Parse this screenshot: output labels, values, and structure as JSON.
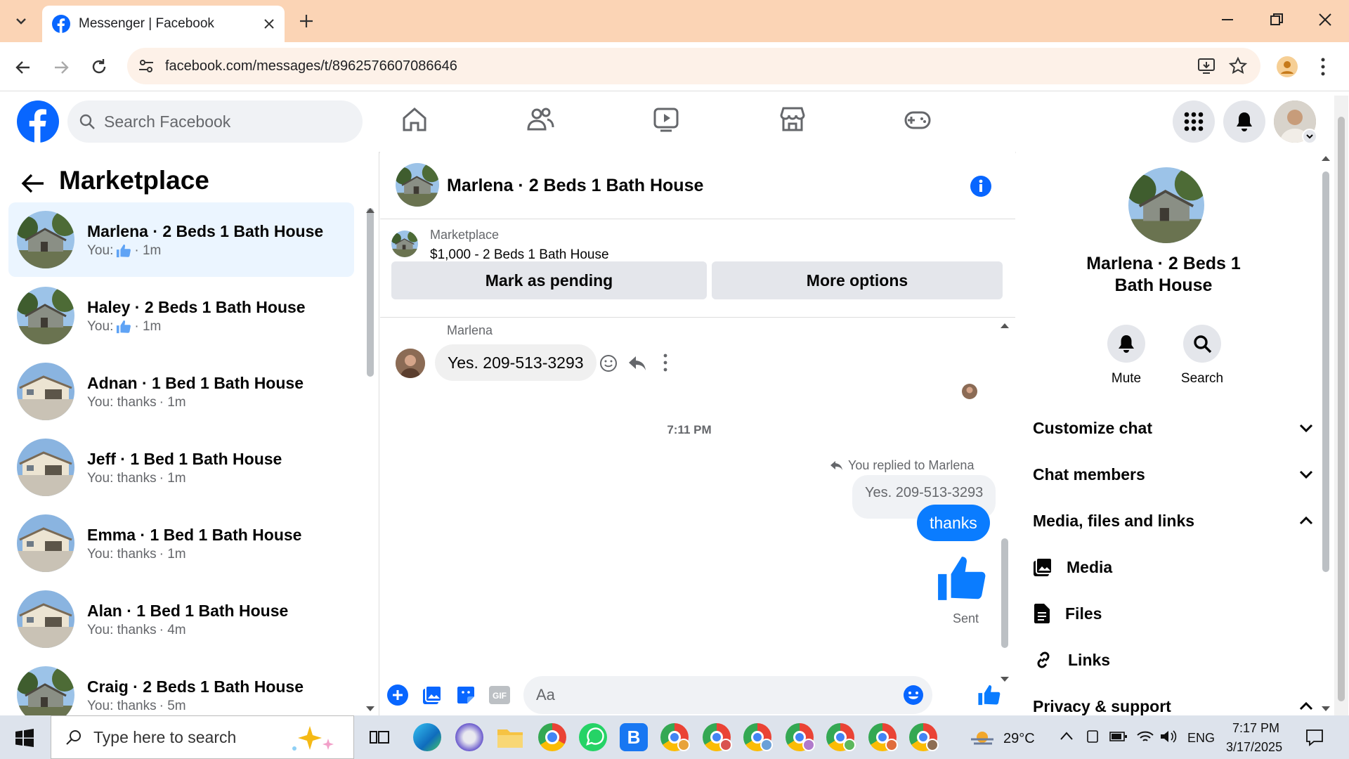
{
  "browser": {
    "tab_title": "Messenger | Facebook",
    "url": "facebook.com/messages/t/8962576607086646"
  },
  "fb": {
    "search_placeholder": "Search Facebook"
  },
  "left": {
    "title": "Marketplace",
    "conversations": [
      {
        "name": "Marlena · 2 Beds 1 Bath House",
        "prefix": "You:",
        "snippet": "",
        "time": "· 1m",
        "like": true,
        "active": true
      },
      {
        "name": "Haley · 2 Beds 1 Bath House",
        "prefix": "You:",
        "snippet": "",
        "time": "· 1m",
        "like": true,
        "active": false
      },
      {
        "name": "Adnan · 1 Bed 1 Bath House",
        "prefix": "You: thanks",
        "snippet": "",
        "time": "· 1m",
        "like": false,
        "active": false
      },
      {
        "name": "Jeff · 1 Bed 1 Bath House",
        "prefix": "You: thanks",
        "snippet": "",
        "time": "· 1m",
        "like": false,
        "active": false
      },
      {
        "name": "Emma · 1 Bed 1 Bath House",
        "prefix": "You: thanks",
        "snippet": "",
        "time": "· 1m",
        "like": false,
        "active": false
      },
      {
        "name": "Alan · 1 Bed 1 Bath House",
        "prefix": "You: thanks",
        "snippet": "",
        "time": "· 4m",
        "like": false,
        "active": false
      },
      {
        "name": "Craig · 2 Beds 1 Bath House",
        "prefix": "You: thanks",
        "snippet": "",
        "time": "· 5m",
        "like": false,
        "active": false
      }
    ]
  },
  "chat": {
    "title": "Marlena · 2 Beds 1 Bath House",
    "listing_label": "Marketplace",
    "listing_title": "$1,000 - 2 Beds 1 Bath House",
    "mark_pending": "Mark as pending",
    "more_options": "More options",
    "sender_name": "Marlena",
    "incoming_message": "Yes. 209-513-3293",
    "timestamp": "7:11 PM",
    "replied_to": "You replied to Marlena",
    "quoted": "Yes. 209-513-3293",
    "outgoing_message": "thanks",
    "sent_status": "Sent",
    "composer_placeholder": "Aa"
  },
  "right": {
    "name": "Marlena · 2 Beds 1 Bath House",
    "mute": "Mute",
    "search": "Search",
    "sections": [
      "Customize chat",
      "Chat members",
      "Media, files and links"
    ],
    "media": "Media",
    "files": "Files",
    "links": "Links",
    "privacy": "Privacy & support"
  },
  "taskbar": {
    "search_placeholder": "Type here to search",
    "weather": "29°C",
    "lang": "ENG",
    "time": "7:17 PM",
    "date": "3/17/2025"
  }
}
